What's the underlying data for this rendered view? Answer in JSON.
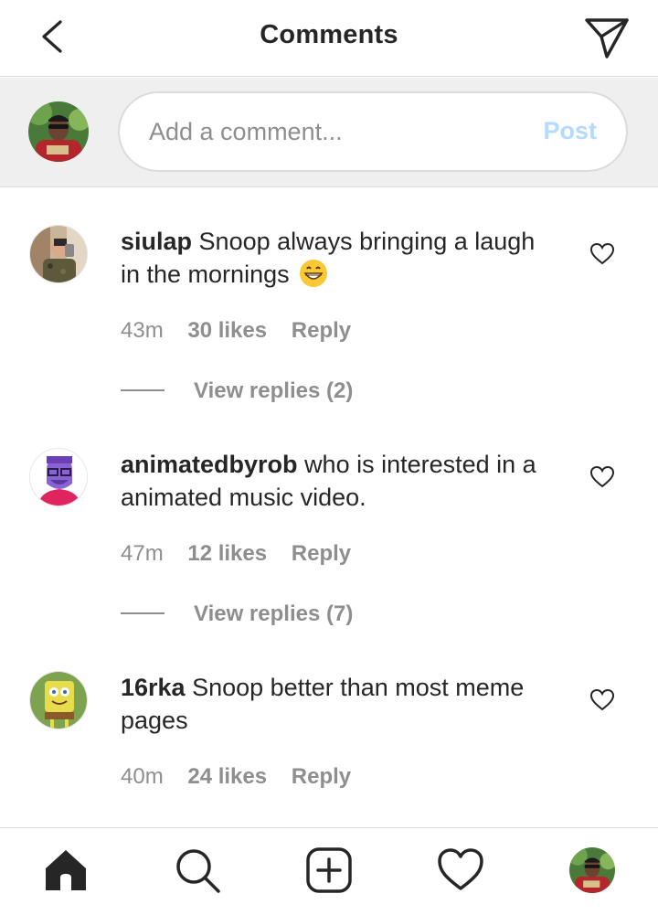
{
  "header": {
    "title": "Comments",
    "back_icon": "chevron-left-icon",
    "send_icon": "paper-plane-icon"
  },
  "compose": {
    "placeholder": "Add a comment...",
    "post_label": "Post",
    "post_color": "#b3dbff"
  },
  "comments": [
    {
      "username": "siulap",
      "text": "Snoop always bringing a laugh in the mornings",
      "emoji": "grinning-face-icon",
      "time": "43m",
      "likes": "30 likes",
      "reply_label": "Reply",
      "view_replies": "View replies (2)"
    },
    {
      "username": "animatedbyrob",
      "text": "who is interested in a animated music video.",
      "time": "47m",
      "likes": "12 likes",
      "reply_label": "Reply",
      "view_replies": "View replies (7)"
    },
    {
      "username": "16rka",
      "text": "Snoop better than most meme pages",
      "time": "40m",
      "likes": "24 likes",
      "reply_label": "Reply"
    }
  ],
  "nav": {
    "items": [
      "home-icon",
      "search-icon",
      "new-post-icon",
      "activity-heart-icon",
      "profile-avatar"
    ]
  },
  "colors": {
    "text": "#262626",
    "secondary_text": "#8e8e8e",
    "divider": "#dbdbdb",
    "compose_bg": "#efefef"
  }
}
